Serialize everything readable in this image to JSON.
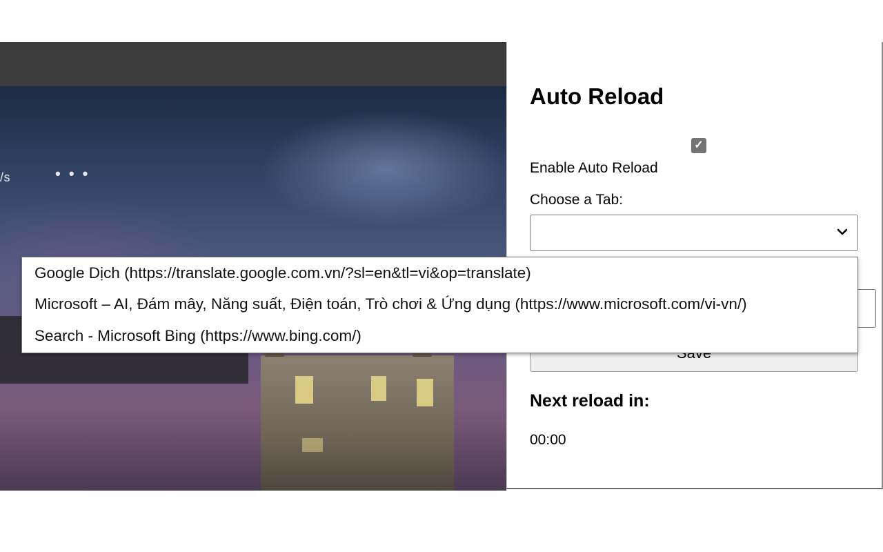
{
  "background_page": {
    "nav_fragment": "/s",
    "more_dots": "• • •"
  },
  "popup": {
    "title": "Auto Reload",
    "enable_label": "Enable Auto Reload",
    "enable_checked": true,
    "checkbox_glyph": "✓",
    "choose_tab_label": "Choose a Tab:",
    "selected_tab": "",
    "save_label": "Save",
    "next_reload_label": "Next reload in:",
    "countdown": "00:00"
  },
  "dropdown": {
    "options": [
      "Google Dịch (https://translate.google.com.vn/?sl=en&tl=vi&op=translate)",
      "Microsoft – AI, Đám mây, Năng suất, Điện toán, Trò chơi & Ứng dụng (https://www.microsoft.com/vi-vn/)",
      "Search - Microsoft Bing (https://www.bing.com/)"
    ]
  },
  "icons": {
    "select_arrow": "chevron-down-icon",
    "checkbox": "checkmark-icon"
  },
  "colors": {
    "topbar": "#3b3b3b",
    "checkbox_fill": "#747474",
    "save_button_bg": "#efefef"
  }
}
